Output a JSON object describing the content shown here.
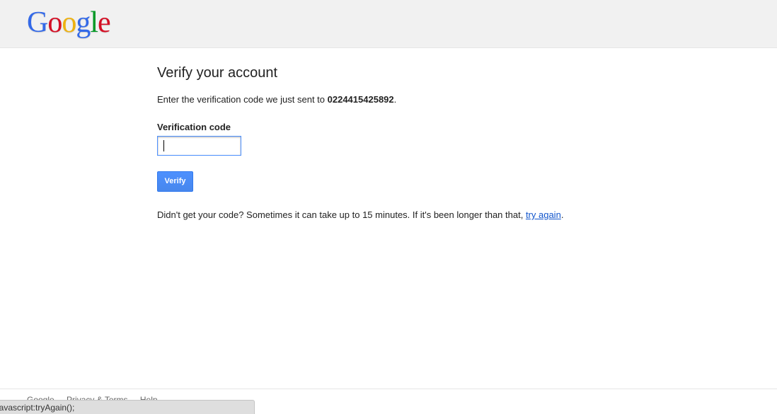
{
  "header": {
    "logo_letters": [
      {
        "char": "G",
        "color": "#3369e8"
      },
      {
        "char": "o",
        "color": "#d50f25"
      },
      {
        "char": "o",
        "color": "#eeb211"
      },
      {
        "char": "g",
        "color": "#3369e8"
      },
      {
        "char": "l",
        "color": "#009925"
      },
      {
        "char": "e",
        "color": "#d50f25"
      }
    ]
  },
  "main": {
    "title": "Verify your account",
    "instructions_prefix": "Enter the verification code we just sent to ",
    "phone_number": "0224415425892",
    "instructions_suffix": ".",
    "code_label": "Verification code",
    "code_value": "",
    "verify_label": "Verify",
    "help_prefix": "Didn't get your code? Sometimes it can take up to 15 minutes. If it's been longer than that, ",
    "help_link": "try again",
    "help_suffix": "."
  },
  "footer": {
    "links": [
      "Google",
      "Privacy & Terms",
      "Help"
    ]
  },
  "statusbar": {
    "text": "javascript:tryAgain();"
  },
  "colors": {
    "accent": "#4d90fe",
    "link": "#1155cc",
    "header_bg": "#f1f1f1"
  }
}
